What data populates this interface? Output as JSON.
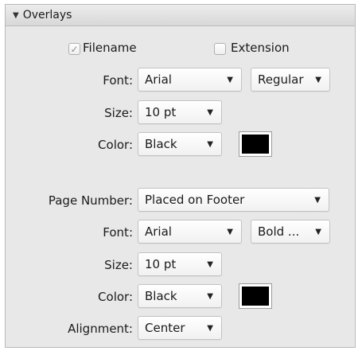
{
  "section": {
    "title": "Overlays",
    "expand_icon": "disclosure-triangle-down-icon"
  },
  "filename": {
    "checkbox_label": "Filename",
    "checked": true,
    "extension_label": "Extension",
    "extension_checked": false,
    "font_label": "Font:",
    "font_value": "Arial",
    "style_value": "Regular",
    "size_label": "Size:",
    "size_value": "10 pt",
    "color_label": "Color:",
    "color_value": "Black",
    "color_swatch": "#000000"
  },
  "page_number": {
    "label": "Page Number:",
    "value": "Placed on Footer",
    "font_label": "Font:",
    "font_value": "Arial",
    "style_value": "Bold ...",
    "size_label": "Size:",
    "size_value": "10 pt",
    "color_label": "Color:",
    "color_value": "Black",
    "color_swatch": "#000000",
    "alignment_label": "Alignment:",
    "alignment_value": "Center"
  },
  "dropdown_arrow_icon": "triangle-down-icon",
  "checkmark_icon": "checkmark-icon"
}
